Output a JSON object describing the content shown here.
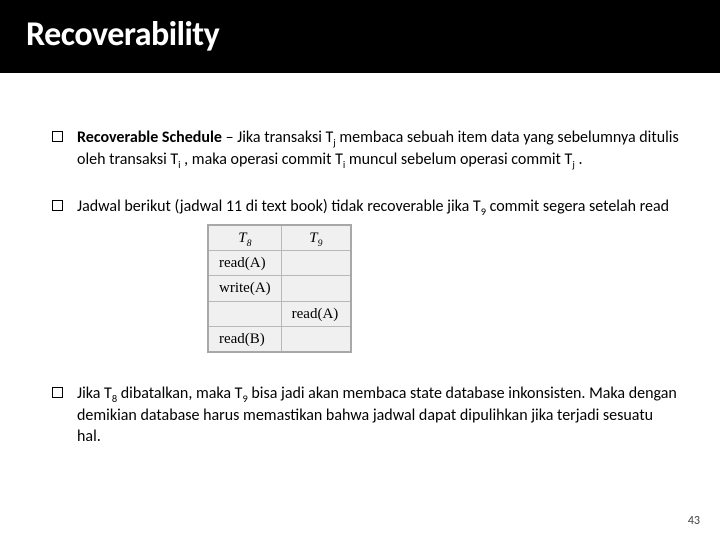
{
  "title": "Recoverability",
  "bullets": {
    "b1_bold": "Recoverable Schedule",
    "b1_rest_a": " – Jika transaksi T",
    "b1_sub_j1": "j",
    "b1_rest_b": " membaca sebuah item data yang sebelumnya ditulis oleh transaksi T",
    "b1_sub_i1": "i",
    "b1_rest_c": " , maka operasi commit  T",
    "b1_sub_i2": "i",
    "b1_rest_d": " muncul sebelum operasi commit T",
    "b1_sub_j2": "j",
    "b1_rest_e": " .",
    "b2_a": "Jadwal berikut (jadwal 11 di text book) tidak recoverable jika T",
    "b2_sub_9": "9",
    "b2_b": " commit segera setelah read",
    "b3_a": "Jika T",
    "b3_sub_8": "8",
    "b3_b": " dibatalkan, maka T",
    "b3_sub_9": "9",
    "b3_c": " bisa jadi akan membaca state database inkonsisten. Maka dengan demikian database harus memastikan bahwa jadwal dapat dipulihkan jika terjadi sesuatu hal."
  },
  "table": {
    "h1_pre": "T",
    "h1_sub": "8",
    "h2_pre": "T",
    "h2_sub": "9",
    "r1c1": "read(A)",
    "r1c2": "",
    "r2c1": "write(A)",
    "r2c2": "",
    "r3c1": "",
    "r3c2": "read(A)",
    "r4c1": "read(B)",
    "r4c2": ""
  },
  "page_number": "43"
}
